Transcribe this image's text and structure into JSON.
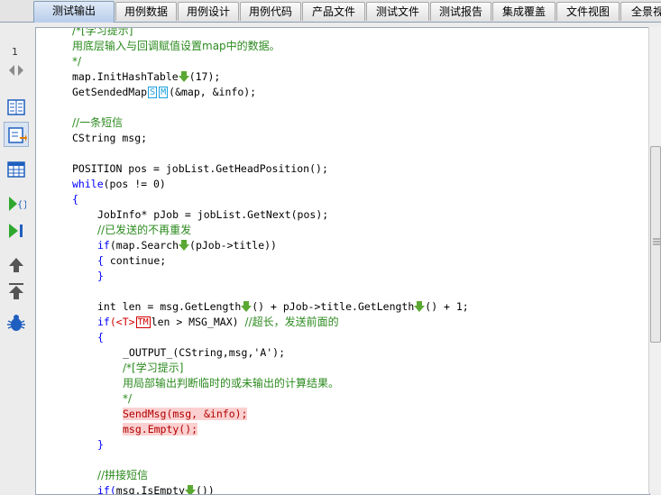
{
  "tabs": [
    {
      "label": "测试输出",
      "active": true
    },
    {
      "label": "用例数据",
      "active": false
    },
    {
      "label": "用例设计",
      "active": false
    },
    {
      "label": "用例代码",
      "active": false
    },
    {
      "label": "产品文件",
      "active": false
    },
    {
      "label": "测试文件",
      "active": false
    },
    {
      "label": "测试报告",
      "active": false
    },
    {
      "label": "集成覆盖",
      "active": false
    },
    {
      "label": "文件视图",
      "active": false
    },
    {
      "label": "全景视",
      "active": false
    }
  ],
  "leftbar": {
    "page_number": "1"
  },
  "code": {
    "l1": "/*[学习提示]",
    "l2": "用底层输入与回调赋值设置map中的数据。",
    "l3": "*/",
    "l4a": "map.InitHashTable",
    "l4b": "(17);",
    "l5a": "GetSendedMap",
    "m_s": "S",
    "m_m": "M",
    "l5b": "(&map, &info);",
    "l7": "//一条短信",
    "l8": "CString msg;",
    "l10": "POSITION pos = jobList.GetHeadPosition();",
    "l11kw": "while",
    "l11b": "(pos != 0)",
    "l12": "{",
    "l13": "JobInfo* pJob = jobList.GetNext(pos);",
    "l14": "//已发送的不再重发",
    "l15kw": "if",
    "l15a": "(map.Search",
    "l15b": "(pJob->title))",
    "l16a": "{",
    "l16b": " continue;",
    "l17": "}",
    "l19a": "int len = msg.GetLength",
    "l19b": "() + pJob->title.GetLength",
    "l19c": "() + 1;",
    "l20kw": "if",
    "l20a": "(<",
    "m_t": "T",
    "l20b": ">",
    "m_tm": "TM",
    "l20c": "len > MSG_MAX)",
    "l20d": "//超长，发送前面的",
    "l21": "{",
    "l22": "_OUTPUT_(CString,msg,'A');",
    "l23": "/*[学习提示]",
    "l24": "用局部输出判断临时的或未输出的计算结果。",
    "l25": "*/",
    "l26": "SendMsg(msg, &info);",
    "l27": "msg.Empty();",
    "l28": "}",
    "l30": "//拼接短信",
    "l31a": "if(",
    "l31b": "msg.IsEmpty",
    "l31c": "())"
  },
  "colors": {
    "comment": "#2b8a1e",
    "keyword": "#0000ff",
    "highlight": "#fbd0d0",
    "accent": "#1aa0e0",
    "marker": "#d40000",
    "arrow": "#5aa832"
  }
}
